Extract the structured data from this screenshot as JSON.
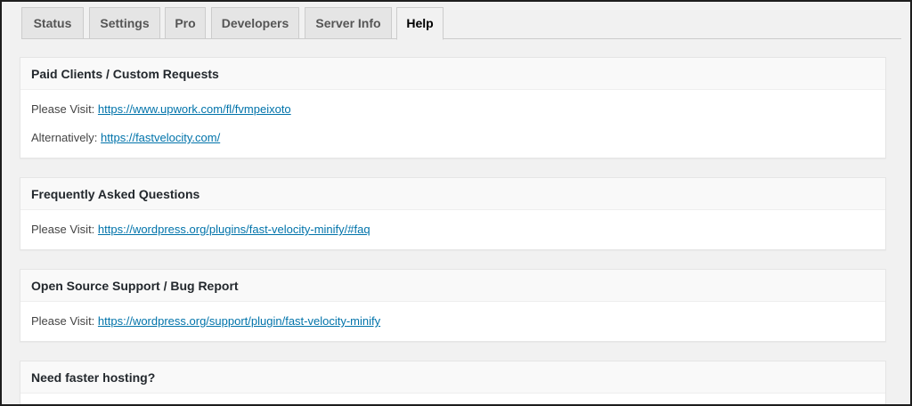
{
  "tabs": [
    {
      "label": "Status",
      "active": false
    },
    {
      "label": "Settings",
      "active": false
    },
    {
      "label": "Pro",
      "active": false
    },
    {
      "label": "Developers",
      "active": false
    },
    {
      "label": "Server Info",
      "active": false
    },
    {
      "label": "Help",
      "active": true
    }
  ],
  "sections": {
    "paid": {
      "title": "Paid Clients / Custom Requests",
      "rows": [
        {
          "label": "Please Visit:",
          "link": "https://www.upwork.com/fl/fvmpeixoto"
        },
        {
          "label": "Alternatively:",
          "link": "https://fastvelocity.com/"
        }
      ]
    },
    "faq": {
      "title": "Frequently Asked Questions",
      "rows": [
        {
          "label": "Please Visit:",
          "link": "https://wordpress.org/plugins/fast-velocity-minify/#faq"
        }
      ]
    },
    "support": {
      "title": "Open Source Support / Bug Report",
      "rows": [
        {
          "label": "Please Visit:",
          "link": "https://wordpress.org/support/plugin/fast-velocity-minify"
        }
      ]
    },
    "hosting": {
      "title": "Need faster hosting?"
    }
  },
  "colors": {
    "link": "#0073aa",
    "background": "#f1f1f1",
    "panel": "#ffffff"
  }
}
